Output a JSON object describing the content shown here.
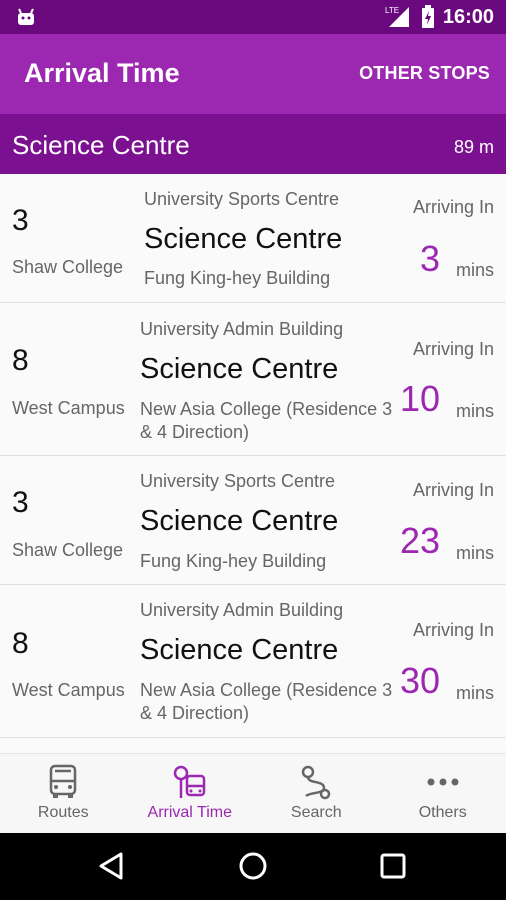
{
  "status_bar": {
    "time": "16:00",
    "network": "LTE"
  },
  "app_bar": {
    "title": "Arrival Time",
    "action": "OTHER STOPS"
  },
  "stop": {
    "name": "Science Centre",
    "distance": "89 m"
  },
  "arrivals": [
    {
      "route": "3",
      "route_name": "Shaw College",
      "from": "University Sports Centre",
      "stop": "Science Centre",
      "to": "Fung King-hey Building",
      "label": "Arriving In",
      "minutes": "3",
      "unit": "mins"
    },
    {
      "route": "8",
      "route_name": "West Campus",
      "from": "University Admin Building",
      "stop": "Science Centre",
      "to": "New Asia College (Residence 3 & 4 Direction)",
      "label": "Arriving In",
      "minutes": "10",
      "unit": "mins"
    },
    {
      "route": "3",
      "route_name": "Shaw College",
      "from": "University Sports Centre",
      "stop": "Science Centre",
      "to": "Fung King-hey Building",
      "label": "Arriving In",
      "minutes": "23",
      "unit": "mins"
    },
    {
      "route": "8",
      "route_name": "West Campus",
      "from": "University Admin Building",
      "stop": "Science Centre",
      "to": "New Asia College (Residence 3 & 4 Direction)",
      "label": "Arriving In",
      "minutes": "30",
      "unit": "mins"
    }
  ],
  "bottom_nav": [
    {
      "label": "Routes",
      "icon": "bus-icon",
      "active": false
    },
    {
      "label": "Arrival Time",
      "icon": "bus-stop-icon",
      "active": true
    },
    {
      "label": "Search",
      "icon": "route-search-icon",
      "active": false
    },
    {
      "label": "Others",
      "icon": "more-dots-icon",
      "active": false
    }
  ],
  "colors": {
    "primary": "#9c27b0",
    "primary_dark": "#6a087d",
    "header_dark": "#7b1190"
  }
}
